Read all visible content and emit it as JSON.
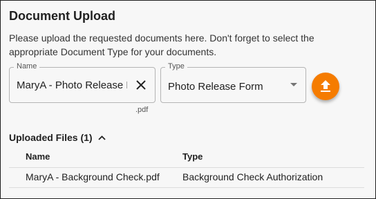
{
  "header": {
    "title": "Document Upload",
    "description": "Please upload the requested documents here. Don't forget to select the appropriate Document Type for your documents."
  },
  "form": {
    "name_label": "Name",
    "name_value": "MaryA - Photo Release Form",
    "extension": ".pdf",
    "clear_icon": "close-icon",
    "type_label": "Type",
    "type_value": "Photo Release Form",
    "upload_icon": "upload-icon",
    "accent_color": "#f57c00"
  },
  "uploaded": {
    "heading": "Uploaded Files (1)",
    "expanded": true,
    "columns": [
      "Name",
      "Type"
    ],
    "rows": [
      [
        "MaryA - Background Check.pdf",
        "Background Check Authorization"
      ]
    ]
  }
}
